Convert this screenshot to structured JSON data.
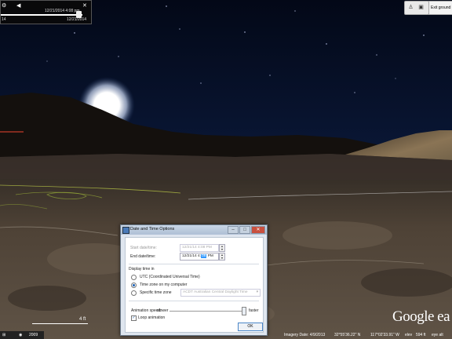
{
  "time_slider": {
    "top_label": "12/21/2014 4:08 pm",
    "bottom_label": "12/21/2014",
    "left_label": "14"
  },
  "toolbar_right": {
    "exit_label": "Exit ground le"
  },
  "scale": {
    "label": "4 ft"
  },
  "logo": {
    "text": "Google ea"
  },
  "taskbar": {
    "item": "2009"
  },
  "status_bar": {
    "imagery_date": "Imagery Date: 4/9/2013",
    "lat": "32°55'36.22\" N",
    "lon": "117°02'33.91\" W",
    "elev_label": "elev",
    "elev": "594 ft",
    "eye_alt_label": "eye alt"
  },
  "dialog": {
    "title": "Date and Time Options",
    "start_label": "Start date/time:",
    "start_value": "12/21/14 4:08 PM",
    "end_label": "End date/time:",
    "end_value_pre": "12/21/14 4:",
    "end_value_sel": "08",
    "end_value_post": " PM",
    "display_label": "Display time in",
    "utc_label": "UTC (Coordinated Universal Time)",
    "local_label": "Time zone on my computer",
    "specific_label": "Specific time zone",
    "timezone_value": "ACDT Australian Central Daylight Time",
    "anim_label": "Animation speed:",
    "slower_label": "slower",
    "faster_label": "faster",
    "loop_label": "Loop animation",
    "ok_label": "OK",
    "close_glyph": "✕",
    "min_glyph": "–",
    "max_glyph": "□"
  }
}
